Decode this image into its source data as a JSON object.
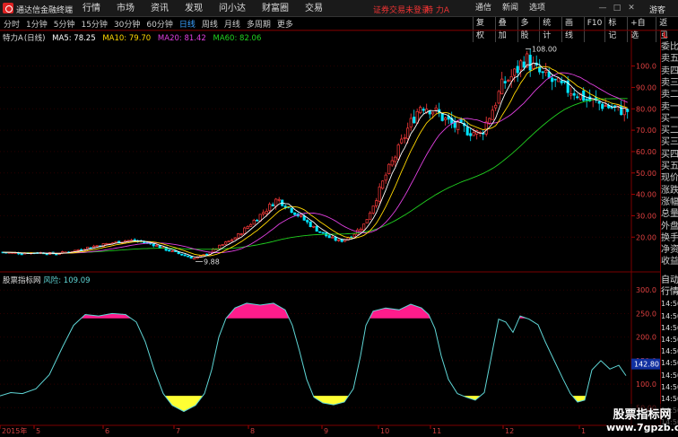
{
  "app": {
    "name": "通达信金融终端"
  },
  "top_menu": [
    "行情",
    "市场",
    "资讯",
    "发现",
    "问小达",
    "财富圈",
    "交易"
  ],
  "status": {
    "text": "证券交易未登录",
    "stock": "特 力A"
  },
  "top_right": [
    "通信",
    "新闻",
    "选项"
  ],
  "guest": "游客",
  "periods": [
    "分时",
    "1分钟",
    "5分钟",
    "15分钟",
    "30分钟",
    "60分钟",
    "日线",
    "周线",
    "月线",
    "多周期",
    "更多"
  ],
  "active_period": "日线",
  "tools": [
    "复权",
    "叠加",
    "多股",
    "统计",
    "画线",
    "F10",
    "标记",
    "+自选",
    "返回"
  ],
  "main_info": {
    "stock": "特力A",
    "period": "(日线)",
    "ma5": "MA5: 78.25",
    "ma10": "MA10: 79.70",
    "ma20": "MA20: 81.42",
    "ma60": "MA60: 82.06"
  },
  "indicator_info": {
    "name": "股票指标网",
    "label": "风险: 109.09"
  },
  "annotations": {
    "high": "108.00",
    "low": "9.88"
  },
  "price_axis": [
    "100.0",
    "90.00",
    "80.00",
    "70.00",
    "60.00",
    "50.00",
    "40.00",
    "30.00",
    "20.00"
  ],
  "ind_axis": [
    "300.0",
    "250.0",
    "200.0",
    "150.0",
    "100.0",
    "50.00"
  ],
  "ind_badge": "142.80",
  "x_labels": [
    "2015年",
    "5",
    "6",
    "7",
    "8",
    "9",
    "10",
    "11",
    "12",
    "1"
  ],
  "side_top": "L",
  "side_items": [
    "委比",
    "卖五",
    "卖四",
    "卖三",
    "卖二",
    "卖一",
    "买一",
    "买二",
    "买三",
    "买四",
    "买五",
    "现价",
    "涨跌",
    "涨幅",
    "总量",
    "外盘",
    "换手",
    "净资",
    "收益"
  ],
  "side_items2": [
    "自动",
    "行情",
    "14:50",
    "14:50",
    "14:50",
    "14:50",
    "14:50",
    "14:50",
    "14:50",
    "14:50",
    "14:50",
    "14:50",
    "14:50"
  ],
  "watermark": {
    "title": "股票指标网",
    "url": "www.7gpzb.com"
  },
  "colors": {
    "up": "#ff3b3b",
    "down": "#00e5ff",
    "ma5": "#ffffff",
    "ma10": "#ffd700",
    "ma20": "#e040e0",
    "ma60": "#20d020",
    "risk": "#5fd6d6",
    "high_zone": "#ff1c8c",
    "low_zone": "#ffff33"
  }
}
